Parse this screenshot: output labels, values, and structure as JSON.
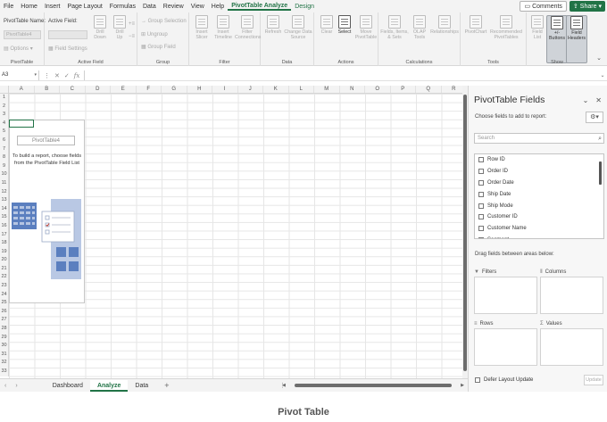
{
  "menu": {
    "items": [
      "File",
      "Home",
      "Insert",
      "Page Layout",
      "Formulas",
      "Data",
      "Review",
      "View",
      "Help",
      "PivotTable Analyze",
      "Design"
    ],
    "comments_label": "Comments",
    "share_label": "Share"
  },
  "ribbon": {
    "pivottable": {
      "name_label": "PivotTable Name:",
      "name_value": "PivotTable4",
      "options_label": "Options",
      "group_label": "PivotTable"
    },
    "active_field": {
      "field_label": "Active Field:",
      "field_settings_label": "Field Settings",
      "drill_down_label": "Drill\nDown",
      "drill_up_label": "Drill\nUp",
      "group_label": "Active Field"
    },
    "group": {
      "group_selection_label": "Group Selection",
      "ungroup_label": "Ungroup",
      "group_field_label": "Group Field",
      "group_label": "Group"
    },
    "filter": {
      "insert_slicer_label": "Insert\nSlicer",
      "insert_timeline_label": "Insert\nTimeline",
      "filter_connections_label": "Filter\nConnections",
      "group_label": "Filter"
    },
    "data": {
      "refresh_label": "Refresh",
      "change_source_label": "Change Data\nSource",
      "group_label": "Data"
    },
    "actions": {
      "clear_label": "Clear",
      "select_label": "Select",
      "move_label": "Move\nPivotTable",
      "group_label": "Actions"
    },
    "calculations": {
      "fields_items_label": "Fields, Items,\n& Sets",
      "olap_label": "OLAP\nTools",
      "relationships_label": "Relationships",
      "group_label": "Calculations"
    },
    "tools": {
      "pivotchart_label": "PivotChart",
      "recommended_label": "Recommended\nPivotTables",
      "group_label": "Tools"
    },
    "show": {
      "field_list_label": "Field\nList",
      "buttons_label": "+/-\nButtons",
      "field_headers_label": "Field\nHeaders",
      "group_label": "Show"
    }
  },
  "formula_bar": {
    "name_box": "A3",
    "fx": "fx",
    "value": ""
  },
  "grid": {
    "columns": [
      "A",
      "B",
      "C",
      "D",
      "E",
      "F",
      "G",
      "H",
      "I",
      "J",
      "K",
      "L",
      "M",
      "N",
      "O",
      "P",
      "Q",
      "R"
    ],
    "rows": [
      "1",
      "2",
      "3",
      "4",
      "5",
      "6",
      "7",
      "8",
      "9",
      "10",
      "11",
      "12",
      "13",
      "14",
      "15",
      "16",
      "17",
      "18",
      "19",
      "20",
      "21",
      "22",
      "23",
      "24",
      "25",
      "26",
      "27",
      "28",
      "29",
      "30",
      "31",
      "32",
      "33"
    ],
    "active_cell": "A3",
    "pivot_placeholder_title": "PivotTable4",
    "pivot_placeholder_hint": "To build a report, choose fields from the PivotTable Field List"
  },
  "sheets": {
    "tabs": [
      "Dashboard",
      "Analyze",
      "Data"
    ],
    "active": "Analyze"
  },
  "pane": {
    "title": "PivotTable Fields",
    "subtitle": "Choose fields to add to report:",
    "search_placeholder": "Search",
    "fields": [
      "Row ID",
      "Order ID",
      "Order Date",
      "Ship Date",
      "Ship Mode",
      "Customer ID",
      "Customer Name",
      "Segment"
    ],
    "drag_hint": "Drag fields between areas below:",
    "areas": {
      "filters": "Filters",
      "columns": "Columns",
      "rows": "Rows",
      "values": "Values"
    },
    "defer_label": "Defer Layout Update",
    "update_label": "Update"
  },
  "caption": "Pivot Table",
  "colors": {
    "excel_green": "#217346",
    "ribbon_bg": "#f3f3f3"
  }
}
